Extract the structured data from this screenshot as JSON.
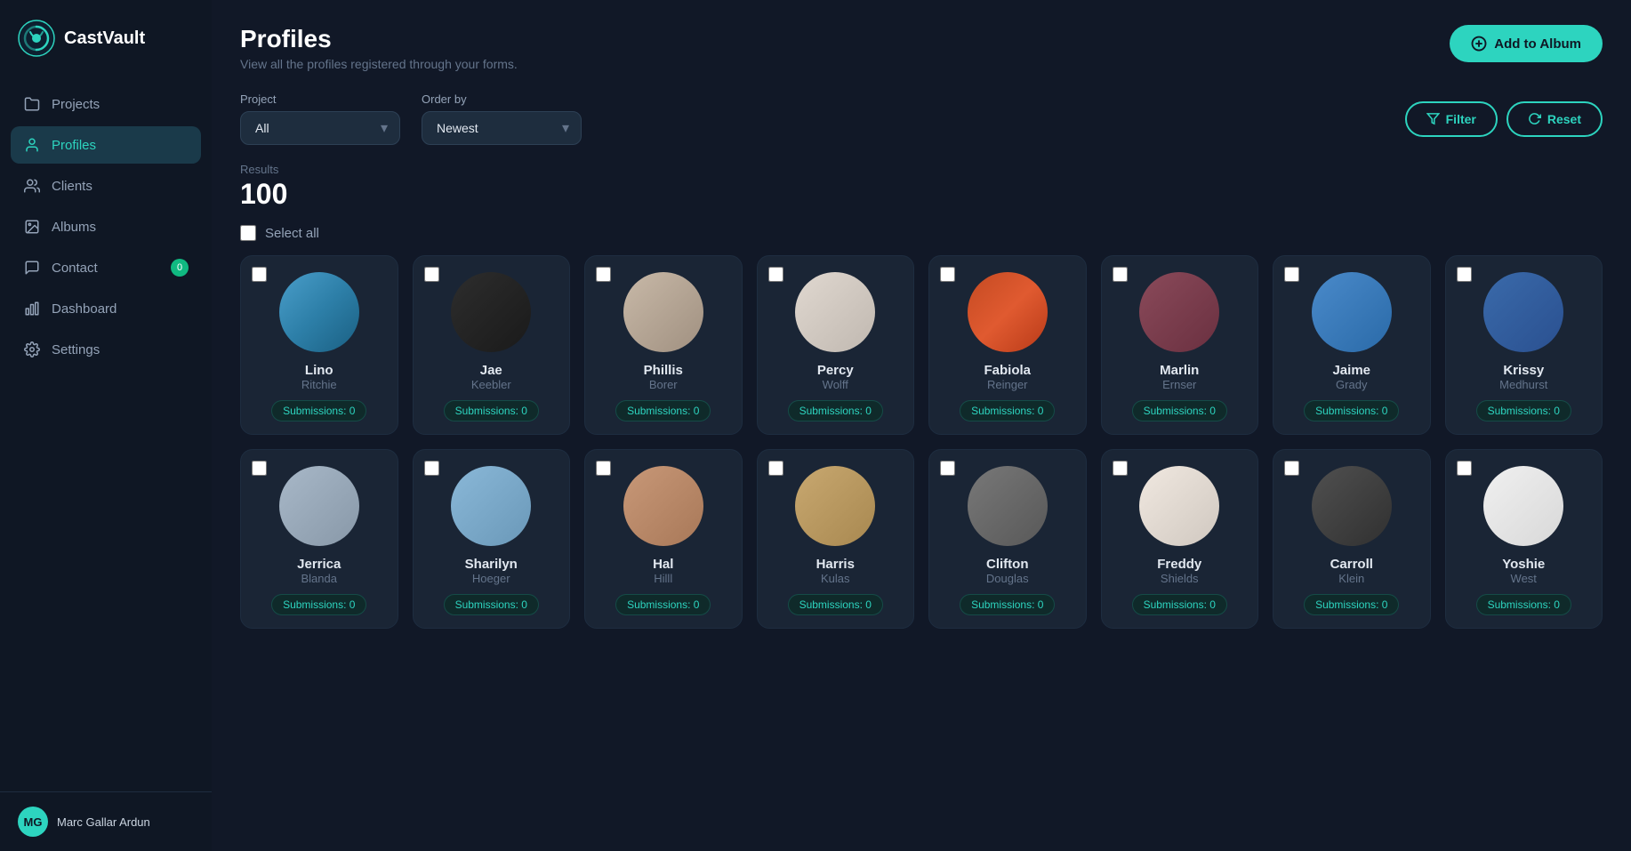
{
  "app": {
    "name": "CastVault"
  },
  "sidebar": {
    "nav_items": [
      {
        "id": "projects",
        "label": "Projects",
        "icon": "folder-icon",
        "active": false,
        "badge": null
      },
      {
        "id": "profiles",
        "label": "Profiles",
        "icon": "user-icon",
        "active": true,
        "badge": null
      },
      {
        "id": "clients",
        "label": "Clients",
        "icon": "users-icon",
        "active": false,
        "badge": null
      },
      {
        "id": "albums",
        "label": "Albums",
        "icon": "image-icon",
        "active": false,
        "badge": null
      },
      {
        "id": "contact",
        "label": "Contact",
        "icon": "chat-icon",
        "active": false,
        "badge": "0"
      },
      {
        "id": "dashboard",
        "label": "Dashboard",
        "icon": "chart-icon",
        "active": false,
        "badge": null
      },
      {
        "id": "settings",
        "label": "Settings",
        "icon": "gear-icon",
        "active": false,
        "badge": null
      }
    ],
    "user": {
      "name": "Marc Gallar Ardun",
      "initials": "MG"
    }
  },
  "header": {
    "title": "Profiles",
    "subtitle": "View all the profiles registered through your forms.",
    "add_album_btn": "Add to Album"
  },
  "filters": {
    "project_label": "Project",
    "project_value": "All",
    "order_label": "Order by",
    "order_value": "Newest",
    "filter_btn": "Filter",
    "reset_btn": "Reset"
  },
  "results": {
    "label": "Results",
    "count": "100"
  },
  "select_all_label": "Select all",
  "profiles_row1": [
    {
      "first": "Lino",
      "last": "Ritchie",
      "submissions": "Submissions: 0",
      "av_class": "av-1"
    },
    {
      "first": "Jae",
      "last": "Keebler",
      "submissions": "Submissions: 0",
      "av_class": "av-2"
    },
    {
      "first": "Phillis",
      "last": "Borer",
      "submissions": "Submissions: 0",
      "av_class": "av-3"
    },
    {
      "first": "Percy",
      "last": "Wolff",
      "submissions": "Submissions: 0",
      "av_class": "av-4"
    },
    {
      "first": "Fabiola",
      "last": "Reinger",
      "submissions": "Submissions: 0",
      "av_class": "av-5"
    },
    {
      "first": "Marlin",
      "last": "Ernser",
      "submissions": "Submissions: 0",
      "av_class": "av-6"
    },
    {
      "first": "Jaime",
      "last": "Grady",
      "submissions": "Submissions: 0",
      "av_class": "av-7"
    },
    {
      "first": "Krissy",
      "last": "Medhurst",
      "submissions": "Submissions: 0",
      "av_class": "av-8"
    }
  ],
  "profiles_row2": [
    {
      "first": "Jerrica",
      "last": "Blanda",
      "submissions": "Submissions: 0",
      "av_class": "av-9"
    },
    {
      "first": "Sharilyn",
      "last": "Hoeger",
      "submissions": "Submissions: 0",
      "av_class": "av-10"
    },
    {
      "first": "Hal",
      "last": "Hilll",
      "submissions": "Submissions: 0",
      "av_class": "av-11"
    },
    {
      "first": "Harris",
      "last": "Kulas",
      "submissions": "Submissions: 0",
      "av_class": "av-12"
    },
    {
      "first": "Clifton",
      "last": "Douglas",
      "submissions": "Submissions: 0",
      "av_class": "av-13"
    },
    {
      "first": "Freddy",
      "last": "Shields",
      "submissions": "Submissions: 0",
      "av_class": "av-14"
    },
    {
      "first": "Carroll",
      "last": "Klein",
      "submissions": "Submissions: 0",
      "av_class": "av-15"
    },
    {
      "first": "Yoshie",
      "last": "West",
      "submissions": "Submissions: 0",
      "av_class": "av-16"
    }
  ]
}
